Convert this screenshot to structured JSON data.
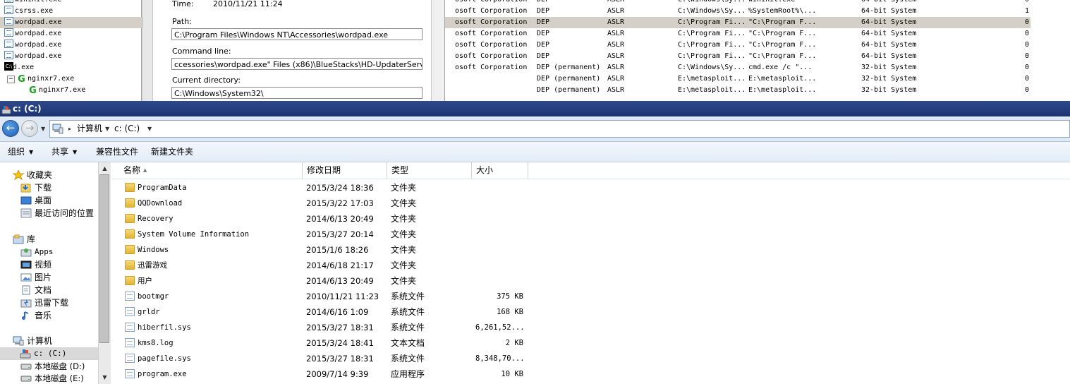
{
  "procexp": {
    "tree": [
      {
        "name": "wininit.exe",
        "icon": "document-icon",
        "selected": false
      },
      {
        "name": "csrss.exe",
        "icon": "document-icon",
        "selected": false
      },
      {
        "name": "wordpad.exe",
        "icon": "document-icon",
        "selected": true
      },
      {
        "name": "wordpad.exe",
        "icon": "document-icon",
        "selected": false
      },
      {
        "name": "wordpad.exe",
        "icon": "document-icon",
        "selected": false
      },
      {
        "name": "wordpad.exe",
        "icon": "document-icon",
        "selected": false
      },
      {
        "name": "cmd.exe",
        "icon": "console-icon",
        "selected": false
      },
      {
        "name": "nginxr7.exe",
        "icon": "nginx-icon",
        "selected": false,
        "expander": "−"
      },
      {
        "name": "nginxr7.exe",
        "icon": "nginx-icon",
        "selected": false
      }
    ],
    "props": {
      "time_label": "Time:",
      "time_value": "2010/11/21 11:24",
      "path_label": "Path:",
      "path_value": "C:\\Program Files\\Windows NT\\Accessories\\wordpad.exe",
      "cmdline_label": "Command line:",
      "cmdline_value": "ccessories\\wordpad.exe\" Files (x86)\\BlueStacks\\HD-UpdaterService.exe",
      "curdir_label": "Current directory:",
      "curdir_value": "C:\\Windows\\System32\\"
    },
    "dll_rows": [
      {
        "company": "osoft Corporation",
        "dep": "DEP",
        "aslr": "ASLR",
        "path": "C:\\Windows\\Sy...",
        "cmd": "wininit.exe",
        "arch": "64-bit System",
        "n": "0",
        "selected": false
      },
      {
        "company": "osoft Corporation",
        "dep": "DEP",
        "aslr": "ASLR",
        "path": "C:\\Windows\\Sy...",
        "cmd": "%SystemRoot%\\...",
        "arch": "64-bit System",
        "n": "1",
        "selected": false
      },
      {
        "company": "osoft Corporation",
        "dep": "DEP",
        "aslr": "ASLR",
        "path": "C:\\Program Fi...",
        "cmd": "\"C:\\Program F...",
        "arch": "64-bit System",
        "n": "0",
        "selected": true
      },
      {
        "company": "osoft Corporation",
        "dep": "DEP",
        "aslr": "ASLR",
        "path": "C:\\Program Fi...",
        "cmd": "\"C:\\Program F...",
        "arch": "64-bit System",
        "n": "0",
        "selected": false
      },
      {
        "company": "osoft Corporation",
        "dep": "DEP",
        "aslr": "ASLR",
        "path": "C:\\Program Fi...",
        "cmd": "\"C:\\Program F...",
        "arch": "64-bit System",
        "n": "0",
        "selected": false
      },
      {
        "company": "osoft Corporation",
        "dep": "DEP",
        "aslr": "ASLR",
        "path": "C:\\Program Fi...",
        "cmd": "\"C:\\Program F...",
        "arch": "64-bit System",
        "n": "0",
        "selected": false
      },
      {
        "company": "osoft Corporation",
        "dep": "DEP (permanent)",
        "aslr": "ASLR",
        "path": "C:\\Windows\\Sy...",
        "cmd": "cmd.exe  /c \"...",
        "arch": "32-bit System",
        "n": "0",
        "selected": false
      },
      {
        "company": "",
        "dep": "DEP (permanent)",
        "aslr": "ASLR",
        "path": "E:\\metasploit...",
        "cmd": "E:\\metasploit...",
        "arch": "32-bit System",
        "n": "0",
        "selected": false
      },
      {
        "company": "",
        "dep": "DEP (permanent)",
        "aslr": "ASLR",
        "path": "E:\\metasploit...",
        "cmd": "E:\\metasploit...",
        "arch": "32-bit System",
        "n": "0",
        "selected": false
      }
    ]
  },
  "explorer": {
    "title": "c:  (C:)",
    "address": {
      "crumbs": [
        "计算机",
        "c:  (C:)"
      ]
    },
    "toolbar": {
      "organize": "组织",
      "share": "共享",
      "compat_files": "兼容性文件",
      "new_folder": "新建文件夹"
    },
    "nav": {
      "favorites": "收藏夹",
      "downloads": "下载",
      "desktop": "桌面",
      "recent": "最近访问的位置",
      "libraries": "库",
      "apps": "Apps",
      "videos": "视频",
      "pictures": "图片",
      "documents": "文档",
      "xunlei": "迅雷下载",
      "music": "音乐",
      "computer": "计算机",
      "drive_c": "c:  (C:)",
      "drive_d": "本地磁盘  (D:)",
      "drive_e": "本地磁盘  (E:)"
    },
    "columns": {
      "name": "名称",
      "modified": "修改日期",
      "type": "类型",
      "size": "大小"
    },
    "files": [
      {
        "name": "ProgramData",
        "date": "2015/3/24 18:36",
        "type": "文件夹",
        "size": "",
        "icon": "folder-icon"
      },
      {
        "name": "QQDownload",
        "date": "2015/3/22 17:03",
        "type": "文件夹",
        "size": "",
        "icon": "folder-icon"
      },
      {
        "name": "Recovery",
        "date": "2014/6/13 20:49",
        "type": "文件夹",
        "size": "",
        "icon": "folder-icon"
      },
      {
        "name": "System Volume Information",
        "date": "2015/3/27 20:14",
        "type": "文件夹",
        "size": "",
        "icon": "folder-icon"
      },
      {
        "name": "Windows",
        "date": "2015/1/6 18:26",
        "type": "文件夹",
        "size": "",
        "icon": "folder-icon"
      },
      {
        "name": "迅雷游戏",
        "date": "2014/6/18 21:17",
        "type": "文件夹",
        "size": "",
        "icon": "folder-icon"
      },
      {
        "name": "用户",
        "date": "2014/6/13 20:49",
        "type": "文件夹",
        "size": "",
        "icon": "folder-icon"
      },
      {
        "name": "bootmgr",
        "date": "2010/11/21 11:23",
        "type": "系统文件",
        "size": "375 KB",
        "icon": "system-file-icon"
      },
      {
        "name": "grldr",
        "date": "2014/6/16 1:09",
        "type": "系统文件",
        "size": "168 KB",
        "icon": "system-file-icon"
      },
      {
        "name": "hiberfil.sys",
        "date": "2015/3/27 18:31",
        "type": "系统文件",
        "size": "6,261,52...",
        "icon": "system-file-icon"
      },
      {
        "name": "kms8.log",
        "date": "2015/3/24 18:41",
        "type": "文本文档",
        "size": "2 KB",
        "icon": "text-file-icon"
      },
      {
        "name": "pagefile.sys",
        "date": "2015/3/27 18:31",
        "type": "系统文件",
        "size": "8,348,70...",
        "icon": "system-file-icon"
      },
      {
        "name": "program.exe",
        "date": "2009/7/14 9:39",
        "type": "应用程序",
        "size": "10 KB",
        "icon": "exe-icon"
      }
    ]
  },
  "colors": {
    "title_bar": "#1c3470",
    "selection": "#d9d9d9",
    "address_bg": "#dfe8f5"
  }
}
